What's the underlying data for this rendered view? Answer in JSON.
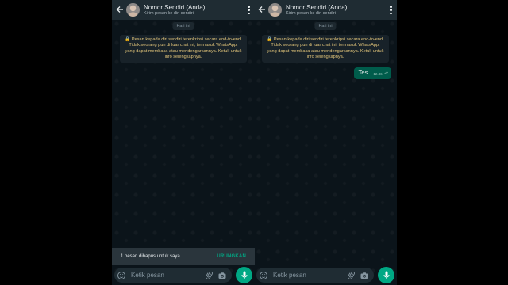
{
  "phones": [
    {
      "header": {
        "title": "Nomor Sendiri (Anda)",
        "subtitle": "Kirim pesan ke diri sendiri"
      },
      "date_chip": "Hari ini",
      "notice": "🔒 Pesan kepada diri sendiri terenkripsi secara end-to-end. Tidak seorang pun di luar chat ini, termasuk WhatsApp, yang dapat membaca atau mendengarkannya. Ketuk untuk info selengkapnya.",
      "snackbar": {
        "text": "1 pesan dihapus untuk saya",
        "action": "URUNGKAN"
      },
      "composer": {
        "placeholder": "Ketik pesan"
      }
    },
    {
      "header": {
        "title": "Nomor Sendiri (Anda)",
        "subtitle": "Kirim pesan ke diri sendiri"
      },
      "date_chip": "Hari ini",
      "notice": "🔒 Pesan kepada diri sendiri terenkripsi secara end-to-end. Tidak seorang pun di luar chat ini, termasuk WhatsApp, yang dapat membaca atau mendengarkannya. Ketuk untuk info selengkapnya.",
      "message": {
        "text": "Tes",
        "time": "12.36",
        "ticks": "✓✓"
      },
      "composer": {
        "placeholder": "Ketik pesan"
      }
    }
  ],
  "icons": {
    "back": "arrow-left",
    "menu": "more-vertical",
    "emoji": "smiley",
    "attach": "paperclip",
    "camera": "camera",
    "mic": "microphone"
  },
  "colors": {
    "background": "#0b141a",
    "header": "#1f2c33",
    "accent": "#00a884",
    "outgoing_bubble": "#005c4b",
    "notice_text": "#e2c57a"
  }
}
